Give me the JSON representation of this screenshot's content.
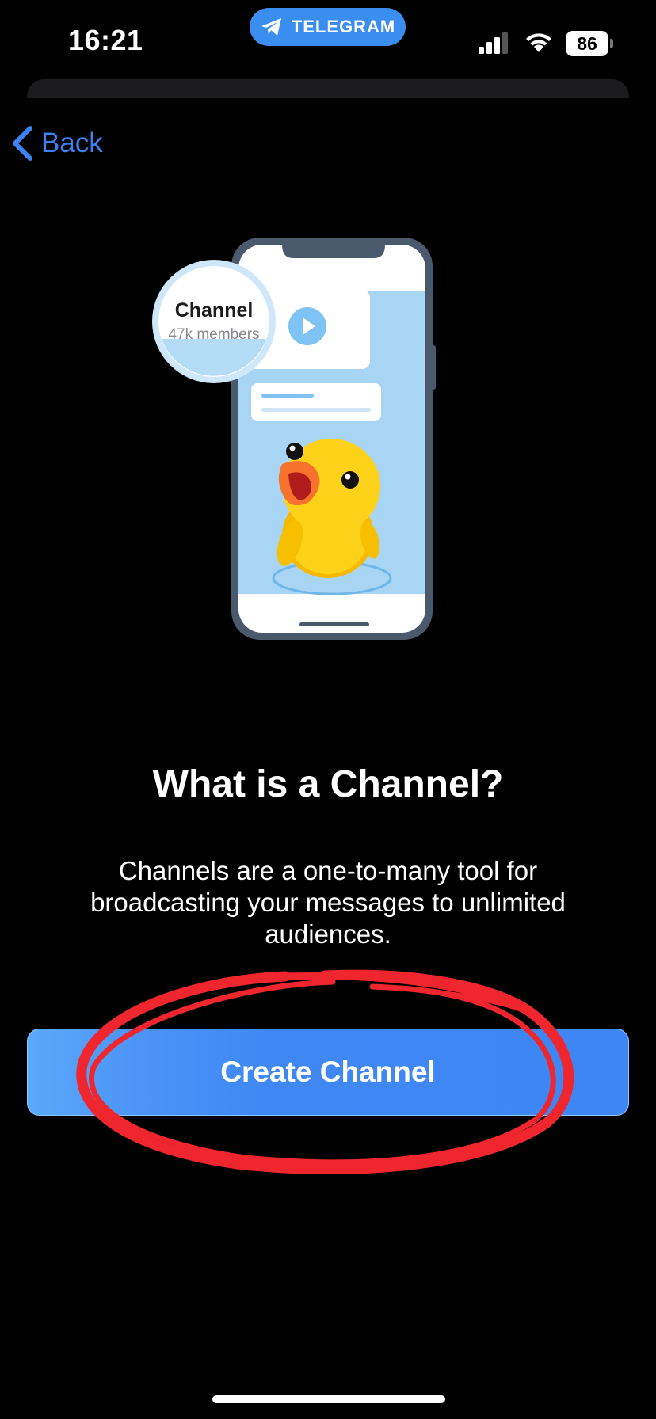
{
  "status_bar": {
    "time": "16:21",
    "app_pill": "TELEGRAM",
    "battery": "86"
  },
  "nav": {
    "back_label": "Back"
  },
  "illustration": {
    "channel_name": "Channel",
    "channel_members": "47k members"
  },
  "content": {
    "title": "What is a Channel?",
    "description": "Channels are a one-to-many tool for broadcasting your messages to unlimited audiences."
  },
  "primary_button": {
    "label": "Create Channel"
  },
  "colors": {
    "accent": "#3b82f6",
    "button": "#3e86f3",
    "annotation": "#f0262e",
    "background": "#000000"
  }
}
